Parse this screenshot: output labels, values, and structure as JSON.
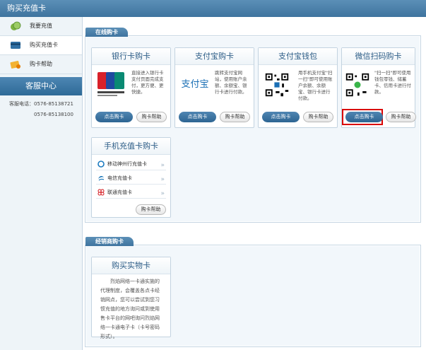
{
  "header": {
    "title": "购买充值卡"
  },
  "sidebar": {
    "items": [
      {
        "label": "我要充值",
        "icon": "coins-icon"
      },
      {
        "label": "购买充值卡",
        "icon": "card-icon"
      },
      {
        "label": "购卡帮助",
        "icon": "help-card-icon"
      }
    ],
    "active_index": 1,
    "service": {
      "title": "客服中心",
      "phone_label": "客服电话：",
      "phone1": "0576-85138721",
      "phone2": "0576-85138100"
    }
  },
  "online": {
    "tab_label": "在线购卡",
    "cards": [
      {
        "title": "银行卡购卡",
        "logo": "unionpay-logo",
        "desc": "直接进入银行卡支付页面完成支付，更方便、更快捷。",
        "buy": "点击购卡",
        "help": "购卡帮助"
      },
      {
        "title": "支付宝购卡",
        "logo": "alipay-logo",
        "logo_text": "支付宝",
        "desc": "跳转支付宝网站，使用账户余额、余额宝、银行卡进行付款。",
        "buy": "点击购卡",
        "help": "购卡帮助"
      },
      {
        "title": "支付宝钱包",
        "logo": "alipay-qr-code",
        "desc": "用手机支付宝\"扫一扫\"即可使用账户余额、余额宝、银行卡进行付款。",
        "buy": "点击购卡",
        "help": "购卡帮助"
      },
      {
        "title": "微信扫码购卡",
        "logo": "wechat-qr-code",
        "desc": "\"扫一扫\"即可使用钱包零钱、储蓄卡、信用卡进行付款。",
        "buy": "点击购卡",
        "help": "购卡帮助"
      }
    ],
    "mobile": {
      "title": "手机充值卡购卡",
      "items": [
        {
          "label": "移动神州行充值卡",
          "icon": "china-mobile-icon"
        },
        {
          "label": "电信充值卡",
          "icon": "china-telecom-icon"
        },
        {
          "label": "联通充值卡",
          "icon": "china-unicom-icon"
        }
      ],
      "help": "购卡帮助"
    }
  },
  "dealer": {
    "tab_label": "经销商购卡",
    "card": {
      "title": "购买实物卡",
      "desc": "烈焰网络一卡通实施的代理制度，会覆盖各点卡经销网点，您可以尝试到您习惯充值的地方询问或到使用售卡平台的网吧询问烈焰网络一卡通电子卡（卡号密码形式）。"
    }
  },
  "colors": {
    "accent": "#3f749f",
    "highlight": "#d90000"
  }
}
